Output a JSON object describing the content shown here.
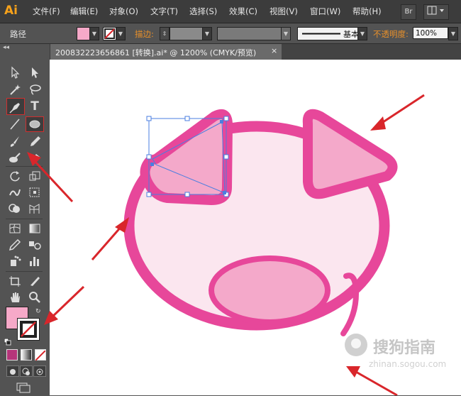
{
  "app": {
    "logo": "Ai"
  },
  "menu": [
    "文件(F)",
    "编辑(E)",
    "对象(O)",
    "文字(T)",
    "选择(S)",
    "效果(C)",
    "视图(V)",
    "窗口(W)",
    "帮助(H)"
  ],
  "bridge_button": "Br",
  "control_bar": {
    "label": "路径",
    "stroke_label": "描边:",
    "stroke_style": "基本",
    "opacity_label": "不透明度:",
    "opacity_value": "100%"
  },
  "document_tab": {
    "title": "200832223656861  [转换].ai* @ 1200% (CMYK/预览)",
    "close": "×"
  },
  "colors": {
    "fill": "#f6a9c8",
    "stroke_red": "#d9262b",
    "pig_outline": "#e7479a",
    "pig_face": "#fbe6ef",
    "pig_inner": "#f4a9ca",
    "arrow": "#d9262b",
    "selection": "#4a7ee0"
  },
  "tools": [
    "selection-tool-icon",
    "direct-selection-tool-icon",
    "magic-wand-tool-icon",
    "lasso-tool-icon",
    "pen-tool-icon",
    "type-tool-icon",
    "line-segment-tool-icon",
    "ellipse-tool-icon",
    "paintbrush-tool-icon",
    "pencil-tool-icon",
    "blob-brush-tool-icon",
    "eraser-tool-icon",
    "rotate-tool-icon",
    "scale-tool-icon",
    "warp-tool-icon",
    "free-transform-tool-icon",
    "shape-builder-tool-icon",
    "perspective-grid-tool-icon",
    "mesh-tool-icon",
    "gradient-tool-icon",
    "eyedropper-tool-icon",
    "blend-tool-icon",
    "symbol-sprayer-tool-icon",
    "column-graph-tool-icon",
    "artboard-tool-icon",
    "slice-tool-icon",
    "hand-tool-icon",
    "zoom-tool-icon"
  ],
  "watermark": {
    "text": "搜狗指南",
    "url": "zhinan.sogou.com"
  }
}
